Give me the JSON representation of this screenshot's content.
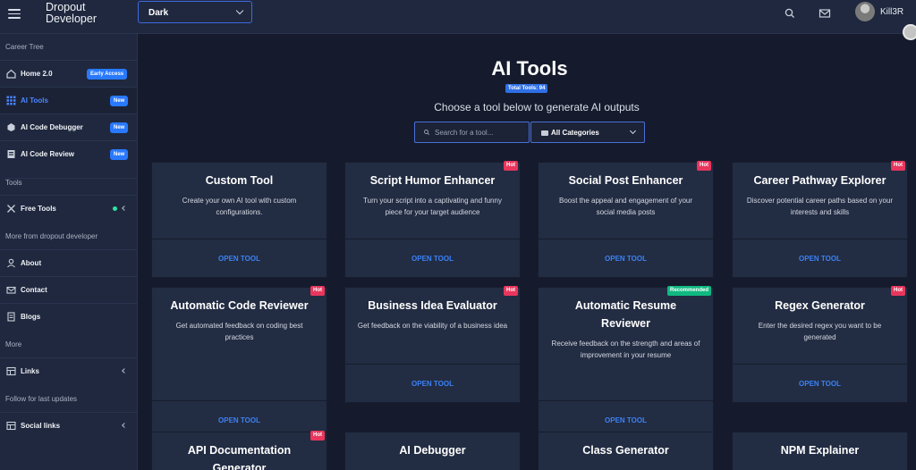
{
  "topbar": {
    "brand": "Dropout\nDeveloper",
    "theme_value": "Dark",
    "user_name": "Kill3R"
  },
  "sidebar": {
    "sections": [
      "Career Tree",
      "Tools",
      "More from dropout developer",
      "More",
      "Follow for last updates"
    ],
    "items": [
      {
        "label": "Home 2.0",
        "badge": "Early Access",
        "icon": "home-icon"
      },
      {
        "label": "AI Tools",
        "badge": "New",
        "icon": "grid-icon"
      },
      {
        "label": "AI Code Debugger",
        "badge": "New",
        "icon": "bug-icon"
      },
      {
        "label": "AI Code Review",
        "badge": "New",
        "icon": "review-icon"
      },
      {
        "label": "Free Tools",
        "icon": "tools-icon"
      },
      {
        "label": "About",
        "icon": "user-icon"
      },
      {
        "label": "Contact",
        "icon": "mail-icon"
      },
      {
        "label": "Blogs",
        "icon": "document-icon"
      },
      {
        "label": "Links",
        "icon": "table-icon"
      },
      {
        "label": "Social links",
        "icon": "table-icon"
      }
    ]
  },
  "main": {
    "title": "AI Tools",
    "total_badge": "Total Tools: 94",
    "subtitle": "Choose a tool below to generate AI outputs",
    "search_placeholder": "Search for a tool...",
    "category_value": "All Categories",
    "open_label": "OPEN TOOL",
    "cards": [
      {
        "title": "Custom Tool",
        "desc": "Create your own AI tool with custom configurations.",
        "tag": ""
      },
      {
        "title": "Script Humor Enhancer",
        "desc": "Turn your script into a captivating and funny piece for your target audience",
        "tag": "Hot"
      },
      {
        "title": "Social Post Enhancer",
        "desc": "Boost the appeal and engagement of your social media posts",
        "tag": "Hot"
      },
      {
        "title": "Career Pathway Explorer",
        "desc": "Discover potential career paths based on your interests and skills",
        "tag": "Hot"
      },
      {
        "title": "Automatic Code Reviewer",
        "desc": "Get automated feedback on coding best practices",
        "tag": "Hot"
      },
      {
        "title": "Business Idea Evaluator",
        "desc": "Get feedback on the viability of a business idea",
        "tag": "Hot"
      },
      {
        "title": "Automatic Resume Reviewer",
        "desc": "Receive feedback on the strength and areas of improvement in your resume",
        "tag": "Recommended"
      },
      {
        "title": "Regex Generator",
        "desc": "Enter the desired regex you want to be generated",
        "tag": "Hot"
      },
      {
        "title": "API Documentation Generator",
        "desc": "",
        "tag": "Hot"
      },
      {
        "title": "AI Debugger",
        "desc": "",
        "tag": ""
      },
      {
        "title": "Class Generator",
        "desc": "",
        "tag": ""
      },
      {
        "title": "NPM Explainer",
        "desc": "",
        "tag": ""
      }
    ]
  }
}
